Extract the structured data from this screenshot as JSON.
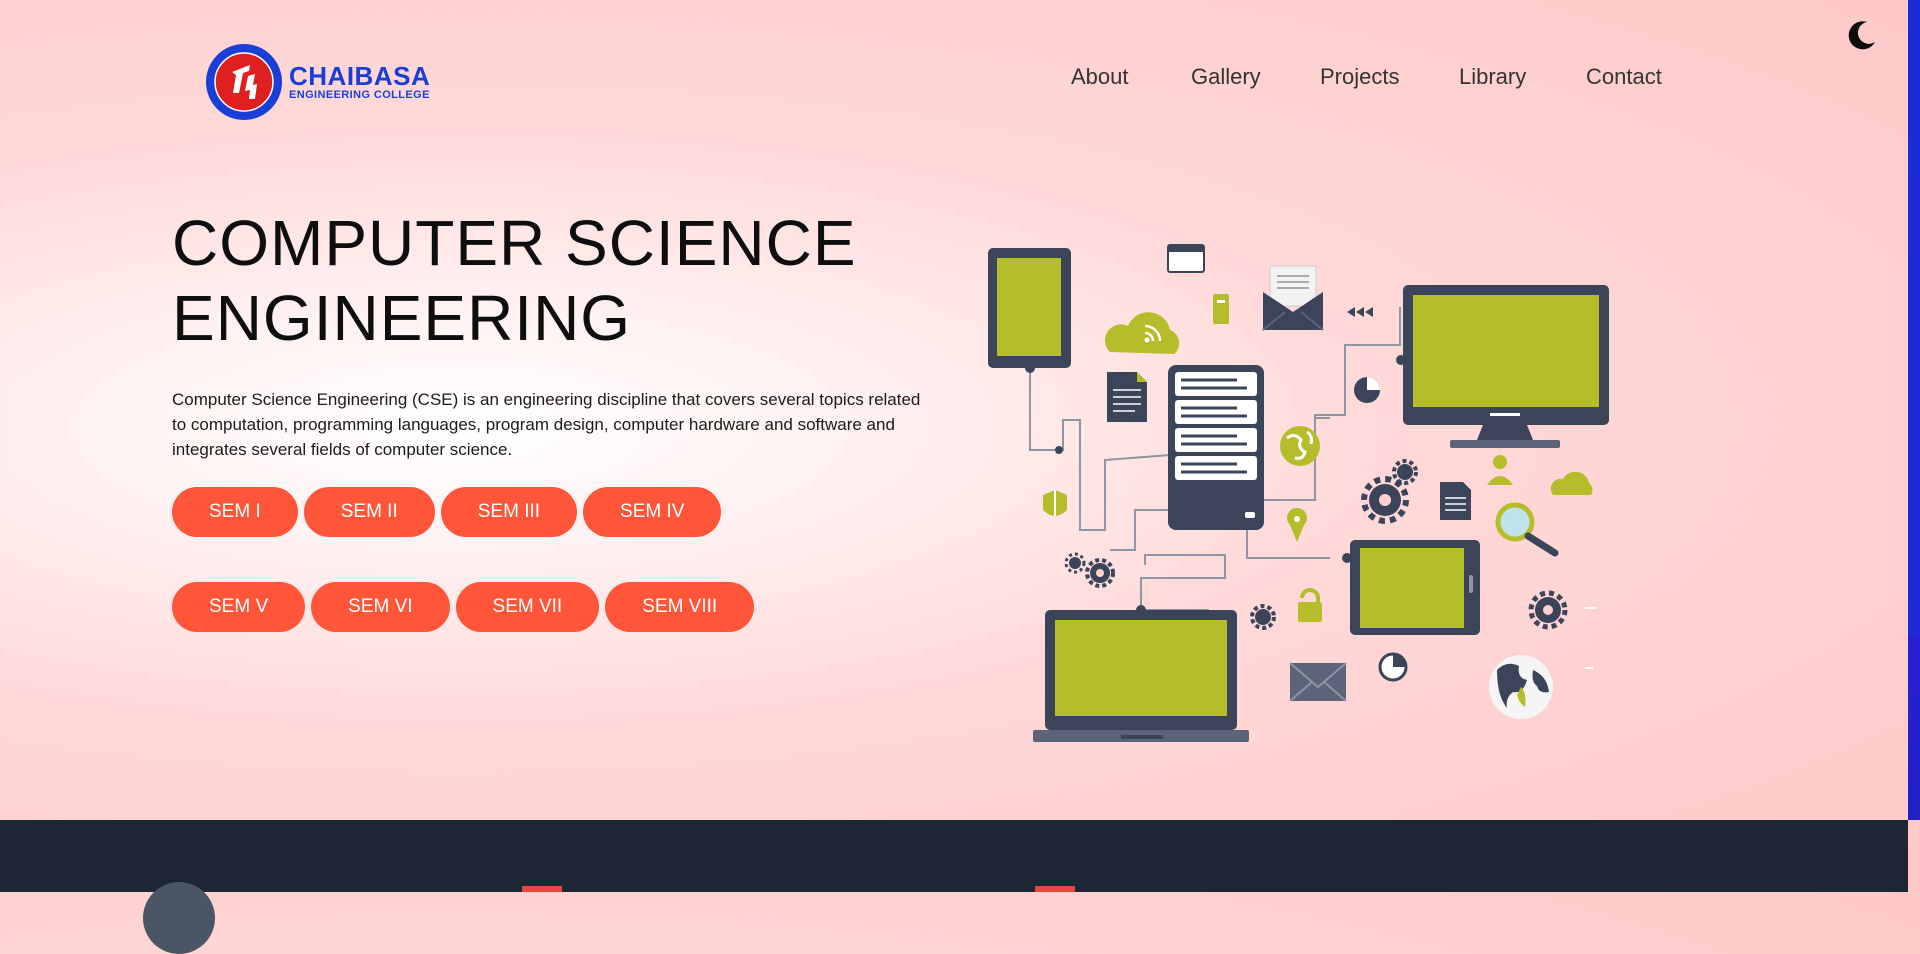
{
  "brand": {
    "name": "CHAIBASA",
    "subtitle": "ENGINEERING COLLEGE",
    "badge_ring_text": "CHAIBASA ENGINEERING COLLEGE",
    "colors": {
      "brand_blue": "#1a3fd6",
      "badge_red": "#e02020"
    }
  },
  "header": {
    "theme_toggle_icon": "moon-icon",
    "nav": [
      "About",
      "Gallery",
      "Projects",
      "Library",
      "Contact"
    ]
  },
  "hero": {
    "title_line1": "COMPUTER SCIENCE",
    "title_line2": "ENGINEERING",
    "description": "Computer Science Engineering (CSE) is an engineering discipline that covers several topics related to computation, programming languages, program design, computer hardware and software and integrates several fields of computer science.",
    "semesters_row1": [
      "SEM I",
      "SEM II",
      "SEM III",
      "SEM IV"
    ],
    "semesters_row2": [
      "SEM V",
      "SEM VI",
      "SEM VII",
      "SEM VIII"
    ],
    "illustration": "computer-network-illustration"
  },
  "colors": {
    "accent": "#ff5538",
    "illustration_screen": "#b5bd2a",
    "illustration_dark": "#3b4459",
    "footer_bg": "#1c2634"
  }
}
